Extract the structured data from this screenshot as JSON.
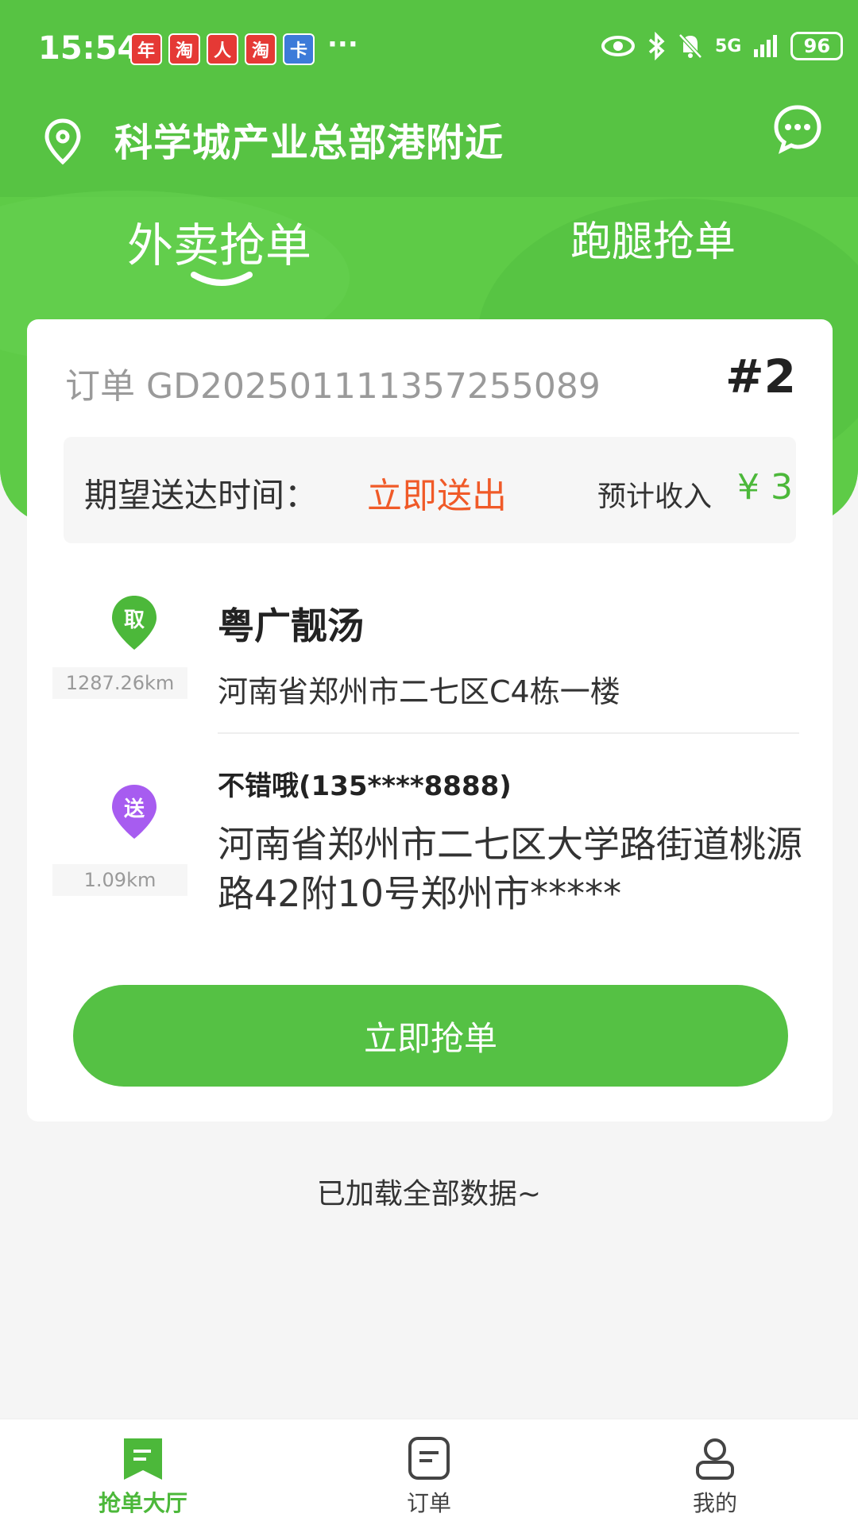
{
  "status_bar": {
    "time": "15:54",
    "notification_icons": [
      "年",
      "淘",
      "人",
      "淘",
      "卡"
    ],
    "overflow": "···",
    "network": "5G",
    "battery": "96"
  },
  "header": {
    "location": "科学城产业总部港附近"
  },
  "tabs": [
    {
      "label": "外卖抢单",
      "active": true
    },
    {
      "label": "跑腿抢单",
      "active": false
    }
  ],
  "order": {
    "number": "订单 GD2025011113572550​89",
    "index": "#2",
    "expect_label": "期望送达时间：",
    "expect_value": "立即送出",
    "income_label": "预计收入",
    "income_value": "¥ 3",
    "pickup": {
      "badge": "取",
      "distance": "1287.26km",
      "name": "粤广靓汤",
      "address": "河南省郑州市二七区C4栋一楼"
    },
    "delivery": {
      "badge": "送",
      "distance": "1.09km",
      "contact": "不错哦(135****8888)",
      "address": "河南省郑州市二七区大学路街道桃源路42附10号郑州市*****"
    },
    "grab_button": "立即抢单"
  },
  "footer_note": "已加载全部数据~",
  "bottom_nav": [
    {
      "label": "抢单大厅",
      "icon": "grab-hall-icon",
      "active": true
    },
    {
      "label": "订单",
      "icon": "order-icon",
      "active": false
    },
    {
      "label": "我的",
      "icon": "profile-icon",
      "active": false
    }
  ],
  "colors": {
    "brand_green": "#55c144",
    "accent_orange": "#f05a28",
    "pickup_pin": "#4cb83a",
    "delivery_pin": "#a75cf0"
  }
}
